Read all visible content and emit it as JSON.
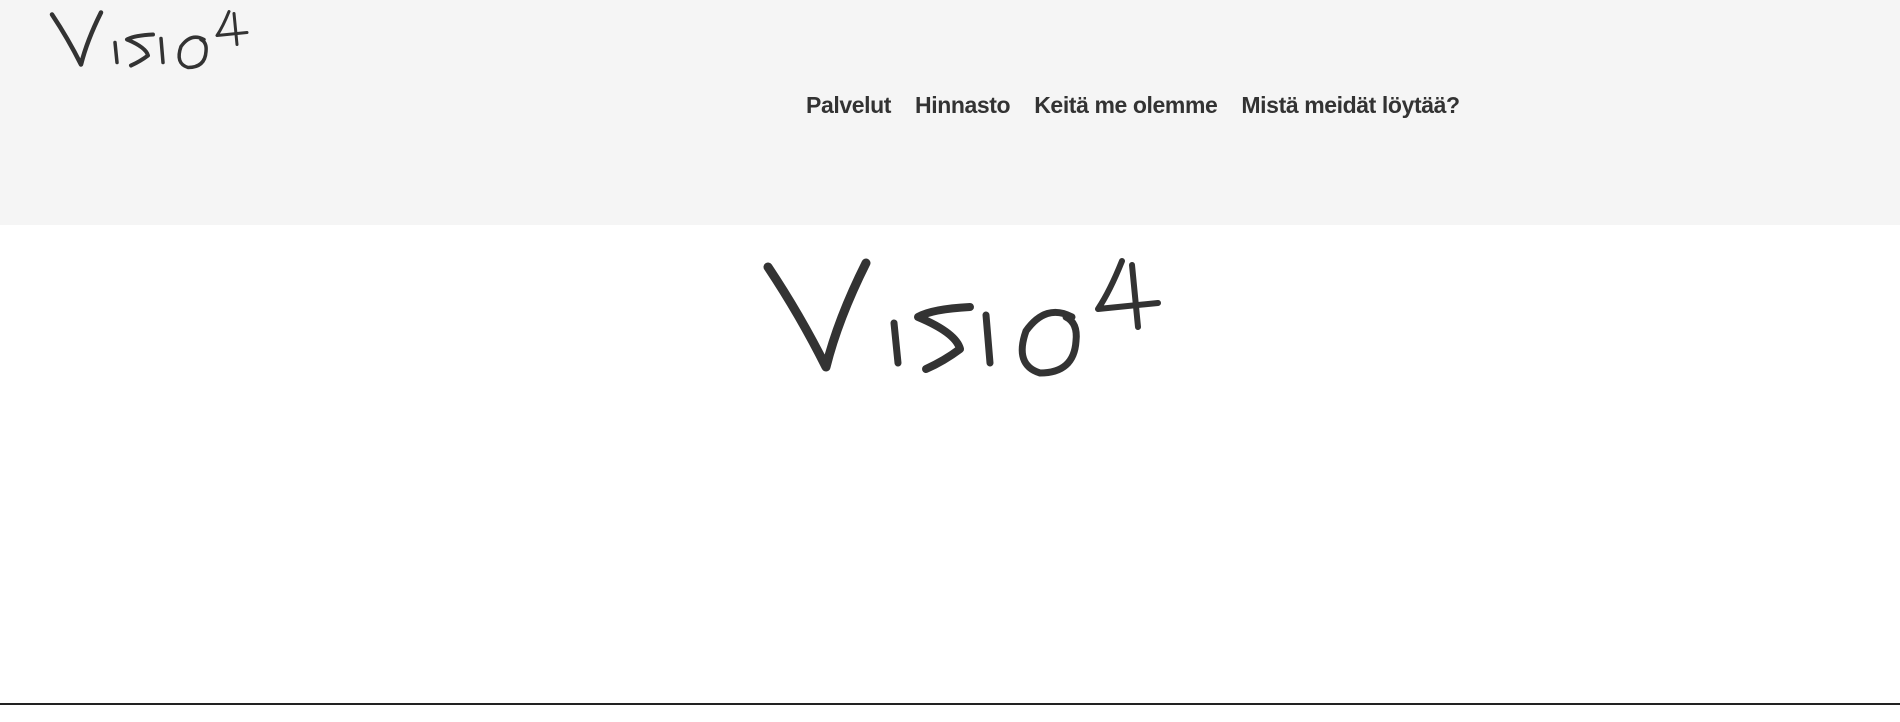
{
  "brand": {
    "name": "Visio4",
    "color": "#333333"
  },
  "header": {
    "background": "#f5f5f5"
  },
  "nav": {
    "items": [
      {
        "label": "Palvelut"
      },
      {
        "label": "Hinnasto"
      },
      {
        "label": "Keitä me olemme"
      },
      {
        "label": "Mistä meidät löytää?"
      }
    ]
  }
}
